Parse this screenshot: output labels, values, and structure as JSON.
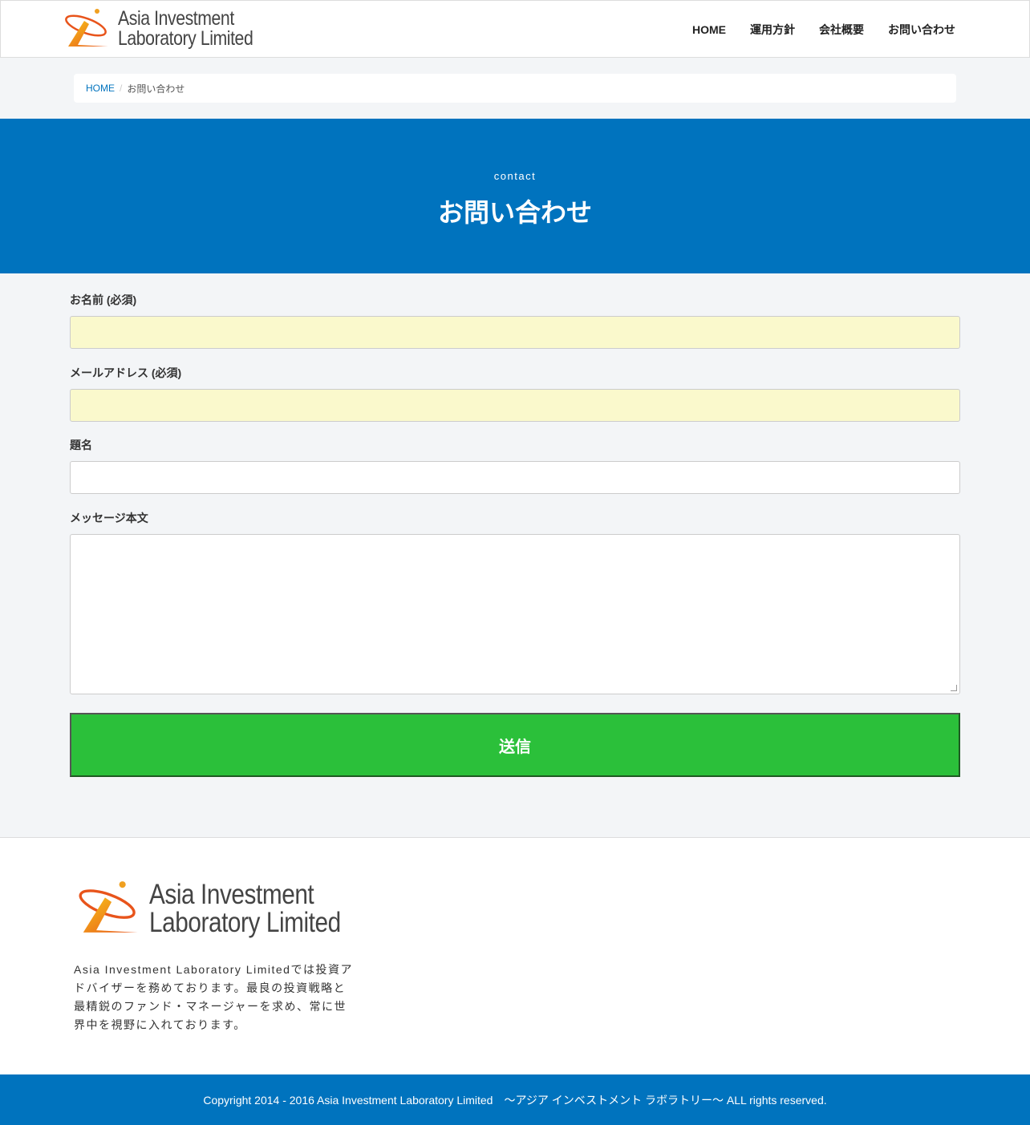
{
  "brand": {
    "line1": "Asia Investment",
    "line2": "Laboratory Limited"
  },
  "nav": [
    {
      "label": "HOME"
    },
    {
      "label": "運用方針"
    },
    {
      "label": "会社概要"
    },
    {
      "label": "お問い合わせ"
    }
  ],
  "breadcrumb": {
    "home": "HOME",
    "separator": "/",
    "current": "お問い合わせ"
  },
  "hero": {
    "subtitle": "contact",
    "title": "お問い合わせ"
  },
  "form": {
    "name_label": "お名前 (必須)",
    "name_value": "",
    "email_label": "メールアドレス (必須)",
    "email_value": "",
    "subject_label": "題名",
    "subject_value": "",
    "message_label": "メッセージ本文",
    "message_value": "",
    "submit_label": "送信"
  },
  "footer": {
    "description": "Asia Investment Laboratory Limitedでは投資アドバイザーを務めております。最良の投資戦略と最精鋭のファンド・マネージャーを求め、常に世界中を視野に入れております。",
    "copyright": "Copyright 2014 - 2016 Asia Investment Laboratory Limited　〜アジア インベストメント ラボラトリー〜 ALL rights reserved."
  },
  "colors": {
    "primary": "#0073be",
    "submit": "#2bc03a",
    "required_field": "#faf9cc"
  }
}
